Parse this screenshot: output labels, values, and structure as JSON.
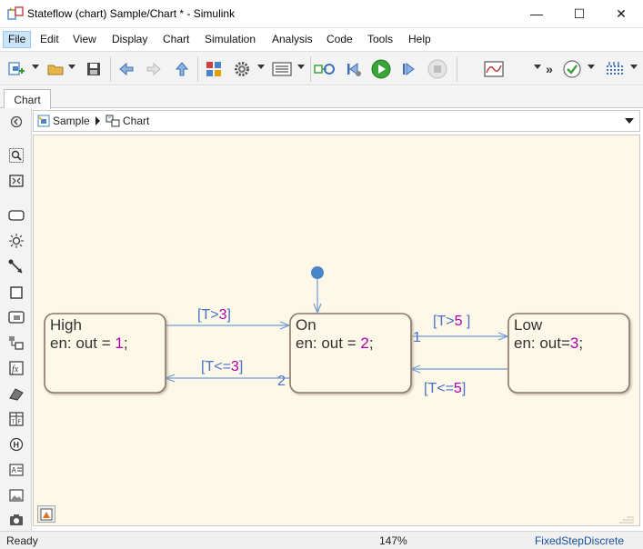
{
  "window": {
    "title": "Stateflow (chart) Sample/Chart * - Simulink",
    "minimize_glyph": "—",
    "maximize_glyph": "☐",
    "close_glyph": "✕"
  },
  "menu": {
    "items": [
      "File",
      "Edit",
      "View",
      "Display",
      "Chart",
      "Simulation",
      "Analysis",
      "Code",
      "Tools",
      "Help"
    ],
    "active": "File"
  },
  "toolbar": {
    "buttons": [
      "new-model-icon",
      "open-folder-icon",
      "save-icon",
      "back-arrow-icon",
      "forward-arrow-icon",
      "up-arrow-icon",
      "library-browser-icon",
      "settings-gear-icon",
      "model-explorer-icon",
      "update-diagram-icon",
      "step-back-icon",
      "run-icon",
      "step-forward-icon",
      "stop-icon",
      "scope-icon",
      "overflow-chevron-icon",
      "check-icon",
      "simulation-data-icon",
      "more-caret-icon"
    ],
    "overflow_label": "»"
  },
  "tabs": [
    {
      "label": "Chart"
    }
  ],
  "breadcrumb": {
    "items": [
      {
        "label": "Sample"
      },
      {
        "label": "Chart"
      }
    ]
  },
  "palette": {
    "tools": [
      "hide-explorer-icon",
      "zoom-icon",
      "fit-view-icon",
      "state-icon",
      "junction-icon",
      "default-transition-icon",
      "box-icon",
      "simulink-function-icon",
      "subchart-icon",
      "matlab-function-icon",
      "simulink-block-icon",
      "truth-table-icon",
      "history-junction-icon",
      "annotation-icon",
      "image-icon",
      "screenshot-icon"
    ]
  },
  "chart": {
    "states": [
      {
        "name": "High",
        "action_prefix": "en: out = ",
        "action_value": "1",
        "action_suffix": ";"
      },
      {
        "name": "On",
        "action_prefix": "en: out = ",
        "action_value": "2",
        "action_suffix": ";"
      },
      {
        "name": "Low",
        "action_prefix": "en: out=",
        "action_value": "3",
        "action_suffix": ";"
      }
    ],
    "transitions": [
      {
        "label_open": "[T>",
        "label_value": "3",
        "label_close": "]",
        "from": "High",
        "to": "On",
        "order": ""
      },
      {
        "label_open": "[T<=",
        "label_value": "3",
        "label_close": "]",
        "from": "On",
        "to": "High",
        "order": "2"
      },
      {
        "label_open": "[T>",
        "label_value": "5",
        "label_close": " ]",
        "from": "On",
        "to": "Low",
        "order": "1"
      },
      {
        "label_open": "[T<=",
        "label_value": "5",
        "label_close": "]",
        "from": "Low",
        "to": "On",
        "order": ""
      }
    ],
    "colors": {
      "canvas": "#fdf8e8",
      "state_fill": "#fdf8e8",
      "state_border": "#8a7a66",
      "transition": "#6f9ad6",
      "label": "#4a72c9",
      "number": "#b000b0",
      "default_junction": "#4a85c9"
    }
  },
  "status": {
    "ready": "Ready",
    "zoom": "147%",
    "solver": "FixedStepDiscrete"
  }
}
